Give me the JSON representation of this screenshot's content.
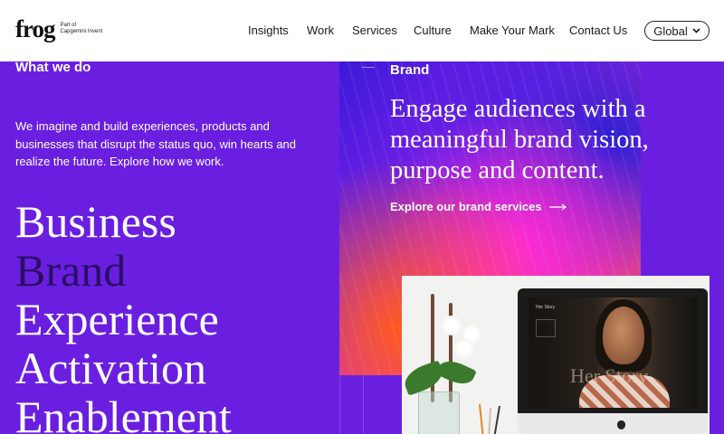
{
  "header": {
    "logo": {
      "word": "frog",
      "sub_line1": "Part of",
      "sub_line2": "Capgemini Invent"
    },
    "nav": [
      "Insights",
      "Work",
      "Services",
      "Culture",
      "Make Your Mark",
      "Contact Us"
    ],
    "region_button": "Global"
  },
  "left": {
    "heading": "What we do",
    "intro": "We imagine and build experiences, products and businesses that disrupt the status quo, win hearts and realize the future. Explore how we work.",
    "services": [
      "Business",
      "Brand",
      "Experience",
      "Activation",
      "Enablement"
    ],
    "active_service": "Brand"
  },
  "card": {
    "label": "Brand",
    "headline": "Engage audiences with a meaningful brand vision, purpose and content.",
    "link": "Explore our brand services"
  },
  "photo": {
    "screen_title": "Her Story",
    "screen_overlay": "Her Story"
  },
  "colors": {
    "background": "#6a1fe0",
    "active_service": "#2a0f66",
    "header": "#ffffff"
  },
  "icons": [
    "chevron-down-icon",
    "arrow-right-icon",
    "apple-logo-icon"
  ]
}
